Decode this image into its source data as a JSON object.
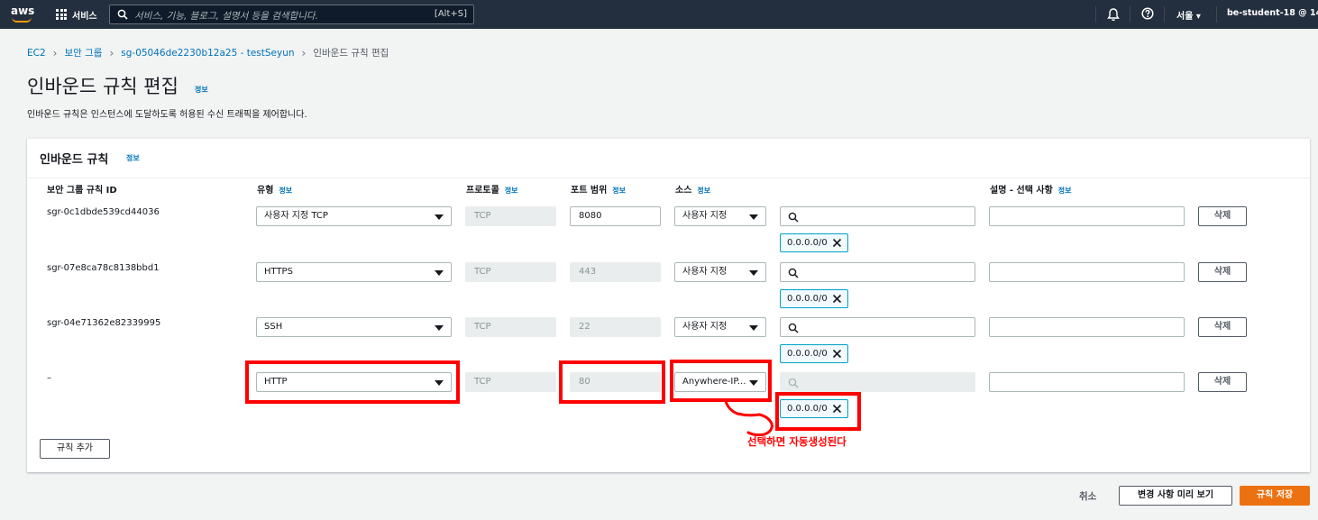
{
  "topnav": {
    "logo_text": "aws",
    "services_label": "서비스",
    "search_placeholder": "서비스, 기능, 블로그, 설명서 등을 검색합니다.",
    "search_shortcut": "[Alt+S]",
    "region": "서울 ▾",
    "account": "be-student-18 @ 1461-4"
  },
  "breadcrumb": {
    "items": [
      "EC2",
      "보안 그룹",
      "sg-05046de2230b12a25 - testSeyun"
    ],
    "current": "인바운드 규칙 편집"
  },
  "page": {
    "title": "인바운드 규칙 편집",
    "info": "정보",
    "subtitle": "인바운드 규칙은 인스턴스에 도달하도록 허용된 수신 트래픽을 제어합니다."
  },
  "panel": {
    "title": "인바운드 규칙",
    "info": "정보",
    "columns": {
      "rule_id": "보안 그룹 규칙 ID",
      "type": "유형",
      "protocol": "프로토콜",
      "port_range": "포트 범위",
      "source": "소스",
      "description": "설명 - 선택 사항"
    },
    "rows": [
      {
        "id": "sgr-0c1dbde539cd44036",
        "type": "사용자 지정 TCP",
        "protocol": "TCP",
        "port": "8080",
        "source": "사용자 지정",
        "cidr": "0.0.0.0/0",
        "delete": "삭제"
      },
      {
        "id": "sgr-07e8ca78c8138bbd1",
        "type": "HTTPS",
        "protocol": "TCP",
        "port": "443",
        "source": "사용자 지정",
        "cidr": "0.0.0.0/0",
        "delete": "삭제"
      },
      {
        "id": "sgr-04e71362e82339995",
        "type": "SSH",
        "protocol": "TCP",
        "port": "22",
        "source": "사용자 지정",
        "cidr": "0.0.0.0/0",
        "delete": "삭제"
      },
      {
        "id": "–",
        "type": "HTTP",
        "protocol": "TCP",
        "port": "80",
        "source": "Anywhere-IP...",
        "cidr": "0.0.0.0/0",
        "delete": "삭제"
      }
    ],
    "add_rule": "규칙 추가"
  },
  "footer": {
    "cancel": "취소",
    "preview": "변경 사항 미리 보기",
    "save": "규칙 저장"
  },
  "annotation": {
    "text": "선택하면 자동생성된다",
    "color": "#ff0000"
  },
  "colors": {
    "nav_bg": "#232f3e",
    "link": "#0073bb",
    "primary": "#ec7211",
    "token_border": "#00a1c9"
  }
}
